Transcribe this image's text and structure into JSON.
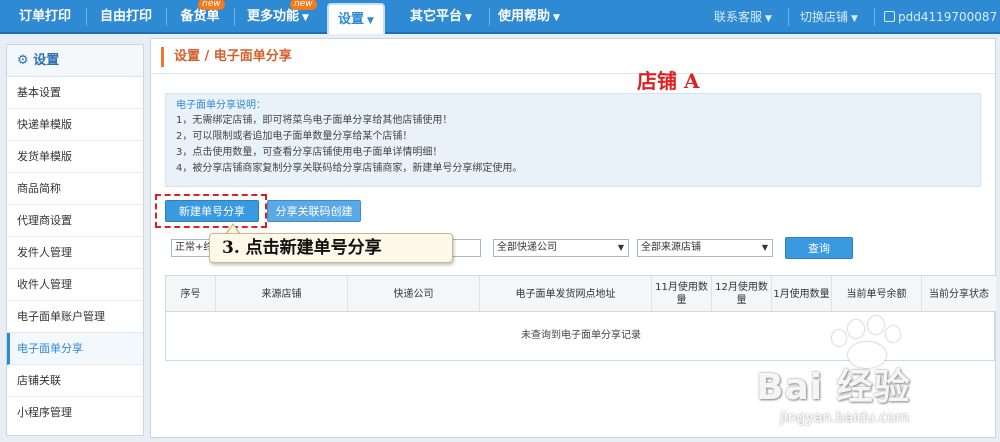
{
  "nav": {
    "items": [
      {
        "label": "订单打印"
      },
      {
        "label": "自由打印"
      },
      {
        "label": "备货单",
        "badge": "new"
      },
      {
        "label": "更多功能",
        "badge": "new"
      },
      {
        "label": "设置"
      },
      {
        "label": "其它平台"
      },
      {
        "label": "使用帮助"
      }
    ],
    "right": {
      "service": "联系客服",
      "switch_store": "切换店铺",
      "user": "pdd4119700087"
    }
  },
  "sidebar": {
    "title": "设置",
    "items": [
      {
        "label": "基本设置"
      },
      {
        "label": "快递单模版"
      },
      {
        "label": "发货单模版"
      },
      {
        "label": "商品简称"
      },
      {
        "label": "代理商设置"
      },
      {
        "label": "发件人管理"
      },
      {
        "label": "收件人管理"
      },
      {
        "label": "电子面单账户管理"
      },
      {
        "label": "电子面单分享"
      },
      {
        "label": "店铺关联"
      },
      {
        "label": "小程序管理"
      }
    ]
  },
  "main": {
    "breadcrumb": "设置 / 电子面单分享",
    "store_annotation": "店铺 A",
    "notice": {
      "title": "电子面单分享说明：",
      "lines": [
        "1，无需绑定店铺，即可将菜鸟电子面单分享给其他店铺使用！",
        "2，可以限制或者追加电子面单数量分享给某个店铺！",
        "3，点击使用数量，可查看分享店铺使用电子面单详情明细！",
        "4，被分享店铺商家复制分享关联码给分享店铺商家，新建单号分享绑定使用。"
      ]
    },
    "buttons": {
      "new_share": "新建单号分享",
      "link_code": "分享关联码创建",
      "query": "查询"
    },
    "filters": {
      "status": "正常+终",
      "express": "全部快递公司",
      "source_store": "全部来源店铺"
    },
    "callout": "3. 点击新建单号分享",
    "table": {
      "headers": [
        "序号",
        "来源店铺",
        "快递公司",
        "电子面单发货网点地址",
        "11月使用数量",
        "12月使用数量",
        "1月使用数量",
        "当前单号余额",
        "当前分享状态"
      ],
      "empty_text": "未查询到电子面单分享记录"
    }
  },
  "watermark": {
    "logo_text": "Bai 经验",
    "url": "jingyan.baidu.com"
  }
}
